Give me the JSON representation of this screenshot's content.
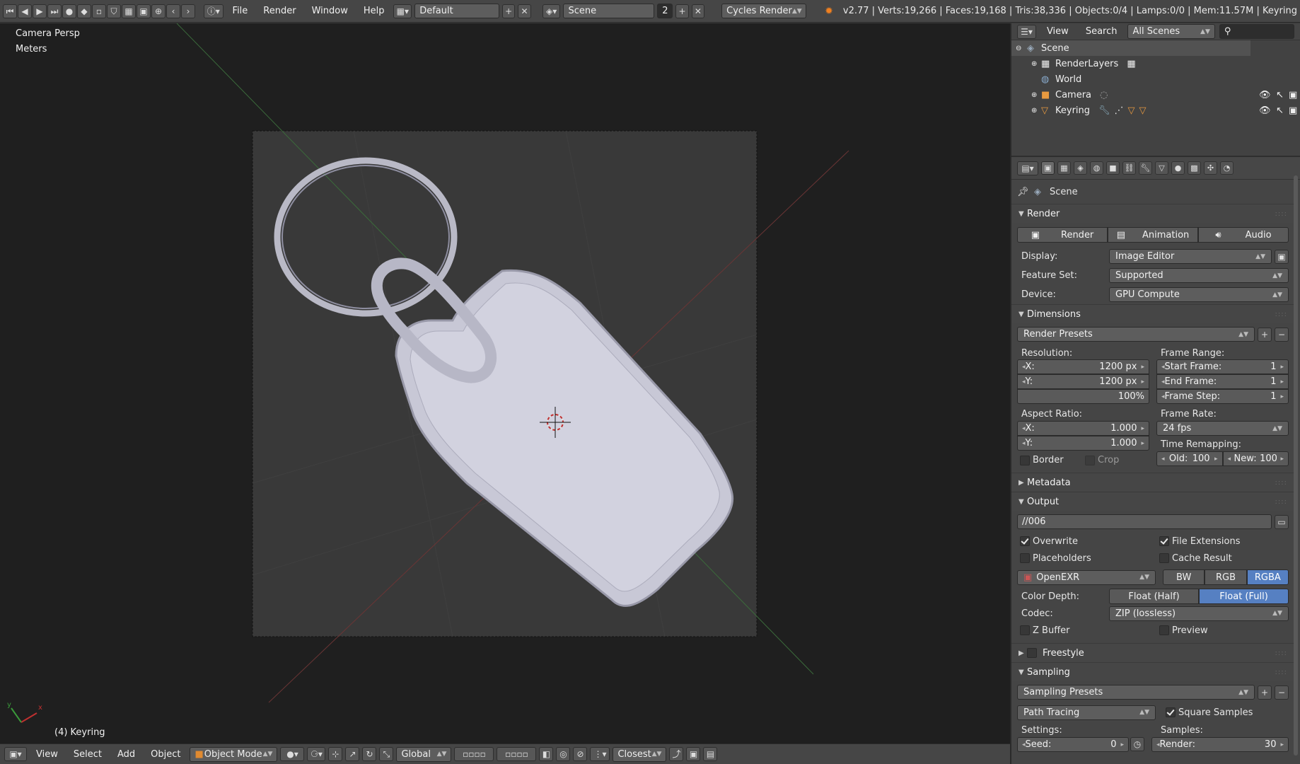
{
  "topbar": {
    "menus": [
      "File",
      "Render",
      "Window",
      "Help"
    ],
    "layout": "Default",
    "scene": "Scene",
    "scene_users": "2",
    "engine": "Cycles Render",
    "info": "v2.77 | Verts:19,266 | Faces:19,168 | Tris:38,336 | Objects:0/4 | Lamps:0/0 | Mem:11.57M | Keyring"
  },
  "viewport": {
    "view_name": "Camera Persp",
    "units": "Meters",
    "object_label": "(4) Keyring"
  },
  "bottombar": {
    "menus": [
      "View",
      "Select",
      "Add",
      "Object"
    ],
    "mode": "Object Mode",
    "orientation": "Global",
    "snap": "Closest"
  },
  "outliner": {
    "menus": [
      "View",
      "Search"
    ],
    "filter": "All Scenes",
    "items": [
      "Scene",
      "RenderLayers",
      "World",
      "Camera",
      "Keyring"
    ]
  },
  "properties": {
    "context": "Scene",
    "render": {
      "title": "Render",
      "buttons": [
        "Render",
        "Animation",
        "Audio"
      ],
      "display_label": "Display:",
      "display": "Image Editor",
      "feature_label": "Feature Set:",
      "feature": "Supported",
      "device_label": "Device:",
      "device": "GPU Compute"
    },
    "dimensions": {
      "title": "Dimensions",
      "presets": "Render Presets",
      "resolution_label": "Resolution:",
      "res_x_label": "X:",
      "res_x": "1200 px",
      "res_y_label": "Y:",
      "res_y": "1200 px",
      "res_pct": "100%",
      "aspect_label": "Aspect Ratio:",
      "asp_x_label": "X:",
      "asp_x": "1.000",
      "asp_y_label": "Y:",
      "asp_y": "1.000",
      "border": "Border",
      "crop": "Crop",
      "frame_range_label": "Frame Range:",
      "start_label": "Start Frame:",
      "start": "1",
      "end_label": "End Frame:",
      "end": "1",
      "step_label": "Frame Step:",
      "step": "1",
      "frame_rate_label": "Frame Rate:",
      "fps": "24 fps",
      "time_remap_label": "Time Remapping:",
      "old_label": "Old:",
      "old": "100",
      "new_label": "New:",
      "new": "100"
    },
    "metadata": {
      "title": "Metadata"
    },
    "output": {
      "title": "Output",
      "path": "//006",
      "overwrite": "Overwrite",
      "file_ext": "File Extensions",
      "placeholders": "Placeholders",
      "cache": "Cache Result",
      "format": "OpenEXR",
      "bw": "BW",
      "rgb": "RGB",
      "rgba": "RGBA",
      "depth_label": "Color Depth:",
      "half": "Float (Half)",
      "full": "Float (Full)",
      "codec_label": "Codec:",
      "codec": "ZIP (lossless)",
      "zbuffer": "Z Buffer",
      "preview": "Preview"
    },
    "freestyle": {
      "title": "Freestyle"
    },
    "sampling": {
      "title": "Sampling",
      "presets": "Sampling Presets",
      "integrator": "Path Tracing",
      "square": "Square Samples",
      "settings_label": "Settings:",
      "samples_label": "Samples:",
      "seed_label": "Seed:",
      "seed": "0",
      "render_label": "Render:",
      "render": "30"
    }
  },
  "colors": {
    "accent": "#5680c2",
    "background": "#393939",
    "viewport": "#1f1f1f"
  }
}
